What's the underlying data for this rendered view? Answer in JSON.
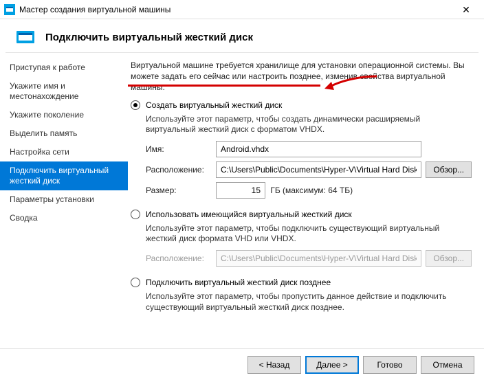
{
  "window": {
    "title": "Мастер создания виртуальной машины"
  },
  "header": {
    "title": "Подключить виртуальный жесткий диск"
  },
  "sidebar": {
    "items": [
      {
        "label": "Приступая к работе"
      },
      {
        "label": "Укажите имя и местонахождение"
      },
      {
        "label": "Укажите поколение"
      },
      {
        "label": "Выделить память"
      },
      {
        "label": "Настройка сети"
      },
      {
        "label": "Подключить виртуальный жесткий диск"
      },
      {
        "label": "Параметры установки"
      },
      {
        "label": "Сводка"
      }
    ],
    "active_index": 5
  },
  "content": {
    "intro": "Виртуальной машине требуется хранилище для установки операционной системы. Вы можете задать его сейчас или настроить позднее, изменив свойства виртуальной машины.",
    "option_create": {
      "label": "Создать виртуальный жесткий диск",
      "desc": "Используйте этот параметр, чтобы создать динамически расширяемый виртуальный жесткий диск с форматом VHDX.",
      "name_label": "Имя:",
      "name_value": "Android.vhdx",
      "location_label": "Расположение:",
      "location_value": "C:\\Users\\Public\\Documents\\Hyper-V\\Virtual Hard Disks\\",
      "browse_label": "Обзор...",
      "size_label": "Размер:",
      "size_value": "15",
      "size_note": "ГБ (максимум: 64 ТБ)"
    },
    "option_use": {
      "label": "Использовать имеющийся виртуальный жесткий диск",
      "desc": "Используйте этот параметр, чтобы подключить существующий виртуальный жесткий диск формата VHD или VHDX.",
      "location_label": "Расположение:",
      "location_value": "C:\\Users\\Public\\Documents\\Hyper-V\\Virtual Hard Disks\\",
      "browse_label": "Обзор..."
    },
    "option_later": {
      "label": "Подключить виртуальный жесткий диск позднее",
      "desc": "Используйте этот параметр, чтобы пропустить данное действие и подключить существующий виртуальный жесткий диск позднее."
    }
  },
  "footer": {
    "back": "< Назад",
    "next": "Далее >",
    "finish": "Готово",
    "cancel": "Отмена"
  }
}
